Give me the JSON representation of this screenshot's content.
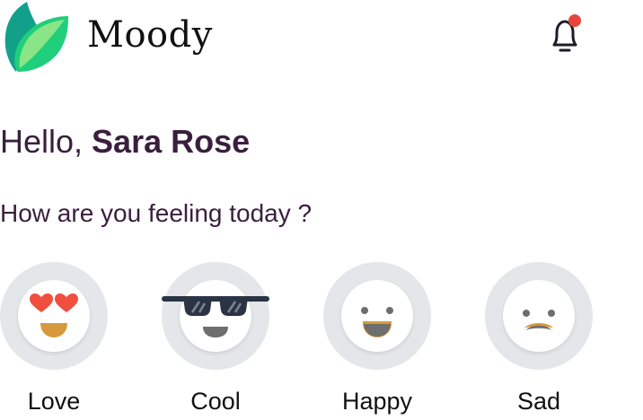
{
  "app": {
    "name": "Moody",
    "notification_dot_color": "#e8453c",
    "logo_colors": [
      "#12a08a",
      "#1fcf7b",
      "#9de98a"
    ]
  },
  "greeting": {
    "prefix": "Hello, ",
    "name": "Sara Rose"
  },
  "question": "How are you feeling today ?",
  "moods": [
    {
      "label": "Love",
      "icon": "heart-eyes-face-icon"
    },
    {
      "label": "Cool",
      "icon": "sunglasses-face-icon"
    },
    {
      "label": "Happy",
      "icon": "smile-face-icon"
    },
    {
      "label": "Sad",
      "icon": "frown-face-icon"
    }
  ],
  "colors": {
    "text_primary": "#3a1f3d",
    "ring": "#e4e6ea",
    "mouth_gold": "#d69a3c",
    "mouth_gray": "#6e6e6e",
    "heart": "#f04e3e"
  }
}
